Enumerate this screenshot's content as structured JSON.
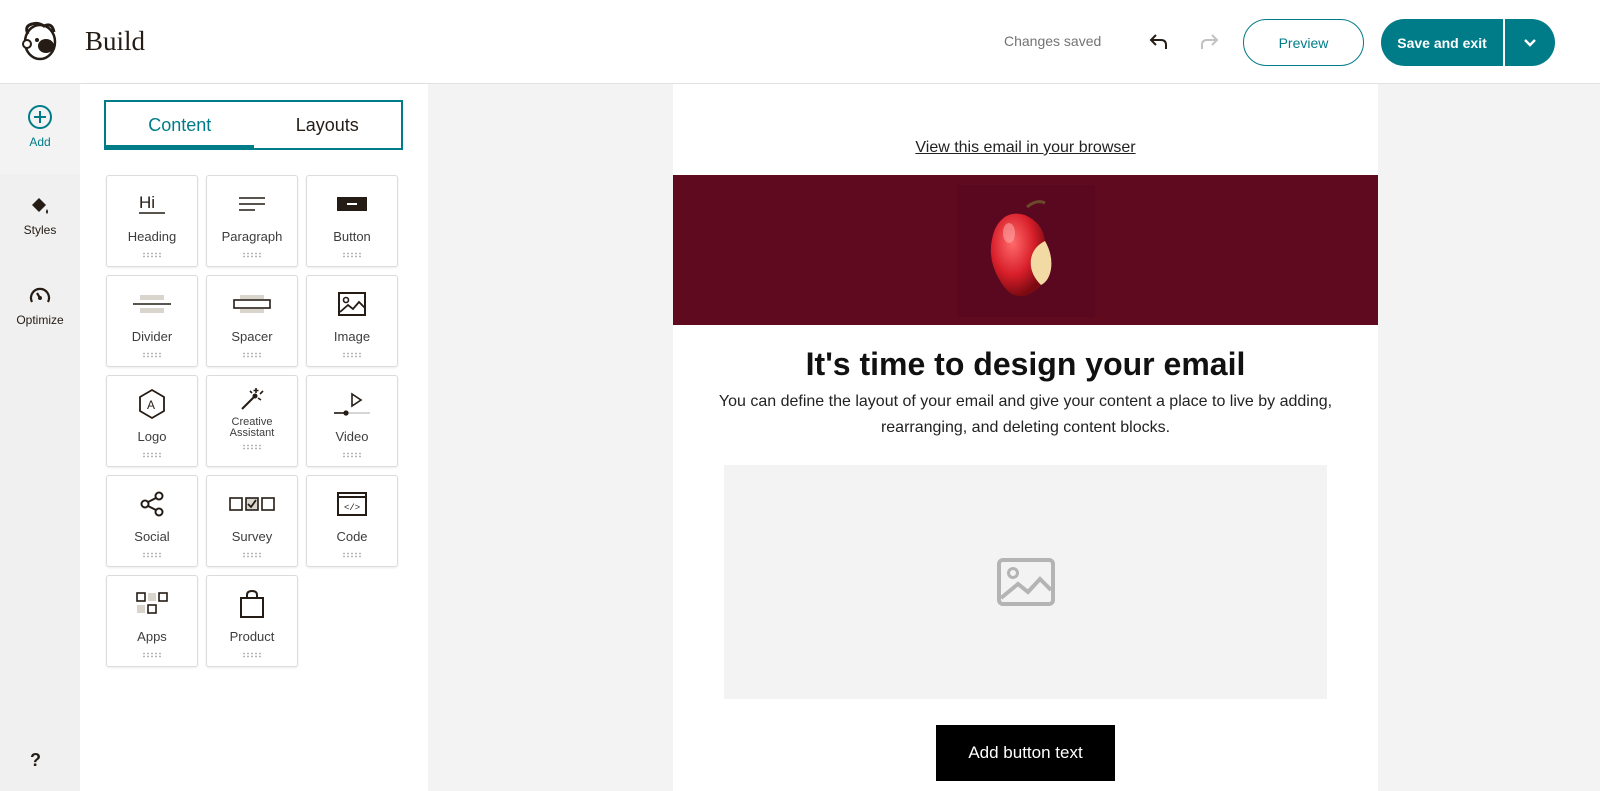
{
  "header": {
    "title": "Build",
    "status": "Changes saved",
    "preview_label": "Preview",
    "save_label": "Save and exit"
  },
  "rail": {
    "add": "Add",
    "styles": "Styles",
    "optimize": "Optimize",
    "help": "?"
  },
  "panel": {
    "tabs": [
      "Content",
      "Layouts"
    ],
    "active_tab": "Content",
    "blocks": [
      {
        "label": "Heading",
        "icon": "heading-icon"
      },
      {
        "label": "Paragraph",
        "icon": "paragraph-icon"
      },
      {
        "label": "Button",
        "icon": "button-icon"
      },
      {
        "label": "Divider",
        "icon": "divider-icon"
      },
      {
        "label": "Spacer",
        "icon": "spacer-icon"
      },
      {
        "label": "Image",
        "icon": "image-icon"
      },
      {
        "label": "Logo",
        "icon": "logo-icon"
      },
      {
        "label": "Creative Assistant",
        "icon": "magic-wand-icon"
      },
      {
        "label": "Video",
        "icon": "video-icon"
      },
      {
        "label": "Social",
        "icon": "share-icon"
      },
      {
        "label": "Survey",
        "icon": "survey-icon"
      },
      {
        "label": "Code",
        "icon": "code-icon"
      },
      {
        "label": "Apps",
        "icon": "apps-icon"
      },
      {
        "label": "Product",
        "icon": "shopping-bag-icon"
      }
    ]
  },
  "email": {
    "view_link": "View this email in your browser",
    "headline": "It's time to design your email",
    "body": "You can define the layout of your email and give your content a place to live by adding, rearranging, and deleting content blocks.",
    "button_text": "Add button text"
  },
  "colors": {
    "accent": "#007c89",
    "hero_bg": "#5f0a1e",
    "cta_bg": "#000000"
  }
}
